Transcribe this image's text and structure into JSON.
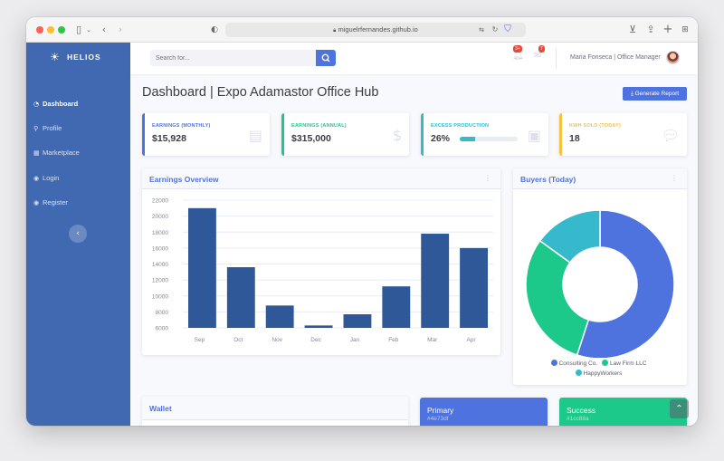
{
  "browser": {
    "url": "miguelrfernandes.github.io"
  },
  "sidebar": {
    "brand": "HELIOS",
    "items": [
      {
        "label": "Dashboard",
        "icon": "dashboard-icon",
        "active": true
      },
      {
        "label": "Profile",
        "icon": "user-icon",
        "active": false
      },
      {
        "label": "Marketplace",
        "icon": "table-icon",
        "active": false
      },
      {
        "label": "Login",
        "icon": "user-circle-icon",
        "active": false
      },
      {
        "label": "Register",
        "icon": "user-circle-icon",
        "active": false
      }
    ]
  },
  "topbar": {
    "search_placeholder": "Search for...",
    "alerts_badge": "3+",
    "messages_badge": "7",
    "user_name": "Maria Fonseca | Office Manager"
  },
  "page": {
    "title": "Dashboard | Expo Adamastor Office Hub",
    "report_button": "Generate Report"
  },
  "stats": [
    {
      "label": "Earnings (Monthly)",
      "value": "$15,928",
      "color": "#4e73df",
      "icon": "calendar-icon"
    },
    {
      "label": "Earnings (Annual)",
      "value": "$315,000",
      "color": "#1cc88a",
      "icon": "dollar-icon"
    },
    {
      "label": "Excess Production",
      "value": "26%",
      "color": "#36b9cc",
      "icon": "clipboard-icon",
      "progress": 0.26
    },
    {
      "label": "KWh Sold (Today)",
      "value": "18",
      "color": "#f6c23e",
      "icon": "comments-icon"
    }
  ],
  "earnings_card": {
    "title": "Earnings Overview"
  },
  "buyers_card": {
    "title": "Buyers (Today)"
  },
  "chart_data": [
    {
      "type": "bar",
      "title": "Earnings Overview",
      "categories": [
        "Sep",
        "Oct",
        "Nov",
        "Dec",
        "Jan",
        "Feb",
        "Mar",
        "Apr"
      ],
      "values": [
        21000,
        13600,
        8800,
        6300,
        7700,
        11200,
        17800,
        16000
      ],
      "ylim": [
        6000,
        22000
      ],
      "yticks": [
        6000,
        8000,
        10000,
        12000,
        14000,
        16000,
        18000,
        20000,
        22000
      ],
      "color": "#2f5899",
      "grid": true
    },
    {
      "type": "pie",
      "title": "Buyers (Today)",
      "labels": [
        "Consulting Co.",
        "Law Firm LLC",
        "HappyWorkers"
      ],
      "values": [
        55,
        30,
        15
      ],
      "colors": [
        "#4e73df",
        "#1cc88a",
        "#36b9cc"
      ],
      "legend": "bottom"
    }
  ],
  "bottom": {
    "wallet_title": "Wallet",
    "primary_title": "Primary",
    "primary_hex": "#4e73df",
    "success_title": "Success",
    "success_hex": "#1cc88a"
  }
}
